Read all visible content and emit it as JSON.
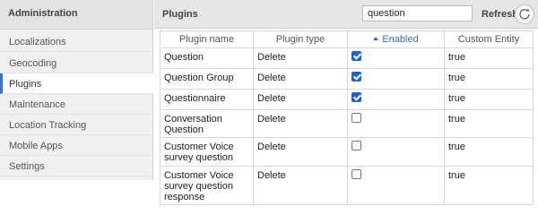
{
  "sidebar": {
    "title": "Administration",
    "items": [
      {
        "label": "Localizations",
        "active": false
      },
      {
        "label": "Geocoding",
        "active": false
      },
      {
        "label": "Plugins",
        "active": true
      },
      {
        "label": "Maintenance",
        "active": false
      },
      {
        "label": "Location Tracking",
        "active": false
      },
      {
        "label": "Mobile Apps",
        "active": false
      },
      {
        "label": "Settings",
        "active": false
      }
    ]
  },
  "header": {
    "title": "Plugins",
    "search_value": "question",
    "refresh_label": "Refresh",
    "refresh_icon": "refresh-icon"
  },
  "table": {
    "columns": [
      "Plugin name",
      "Plugin type",
      "Enabled",
      "Custom Entity"
    ],
    "sorted_column": "Enabled",
    "sort_direction": "ascending",
    "rows": [
      {
        "name": "Question",
        "type": "Delete",
        "enabled": true,
        "custom_entity": "true"
      },
      {
        "name": "Question Group",
        "type": "Delete",
        "enabled": true,
        "custom_entity": "true"
      },
      {
        "name": "Questionnaire",
        "type": "Delete",
        "enabled": true,
        "custom_entity": "true"
      },
      {
        "name": "Conversation Question",
        "type": "Delete",
        "enabled": false,
        "custom_entity": "true"
      },
      {
        "name": "Customer Voice survey question",
        "type": "Delete",
        "enabled": false,
        "custom_entity": "true"
      },
      {
        "name": "Customer Voice survey question response",
        "type": "Delete",
        "enabled": false,
        "custom_entity": "true"
      }
    ]
  },
  "colors": {
    "accent": "#1e63d1",
    "sidebar_bg": "#f0f0f0",
    "header_bg": "#e6e6e6"
  }
}
